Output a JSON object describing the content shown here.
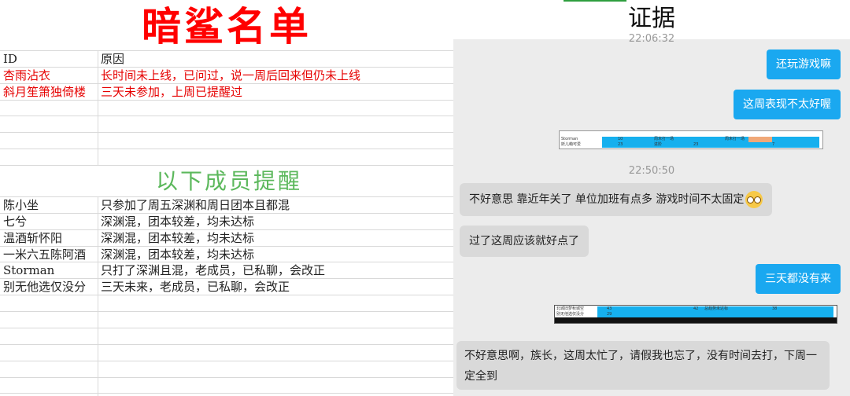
{
  "sheet": {
    "title": "暗鲨名单",
    "header": {
      "id": "ID",
      "reason": "原因"
    },
    "red_rows": [
      {
        "name": "杏雨沾衣",
        "reason": "长时间未上线，已问过，说一周后回来但仍未上线"
      },
      {
        "name": "斜月笙箫独倚楼",
        "reason": "三天未参加，上周已提醒过"
      }
    ],
    "subtitle": "以下成员提醒",
    "warn_rows": [
      {
        "name": "陈小坐",
        "reason": "只参加了周五深渊和周日团本且都混"
      },
      {
        "name": "七兮",
        "reason": "深渊混，团本较差，均未达标"
      },
      {
        "name": "温酒斩怀阳",
        "reason": "深渊混，团本较差，均未达标"
      },
      {
        "name": "一米六五陈阿酒",
        "reason": "深渊混，团本较差，均未达标"
      },
      {
        "name": "Storman",
        "reason": "只打了深渊且混，老成员，已私聊，会改正"
      },
      {
        "name": "别无他选仅没分",
        "reason": "三天未来，老成员，已私聊，会改正"
      }
    ],
    "colors": {
      "title": "#ff0000",
      "red_text": "#e60000",
      "subtitle": "#5cb85c"
    }
  },
  "chat": {
    "title": "证据",
    "timestamp_top": "22:06:32",
    "msg1": "还玩游戏嘛",
    "msg2": "这周表现不太好喔",
    "table1": {
      "rows": [
        "Storman",
        "妖儿萌可爱"
      ],
      "cells": [
        "10",
        "周末打一场",
        "周末打一场",
        "23",
        "进阶",
        "23",
        "7"
      ]
    },
    "timestamp_mid": "22:50:50",
    "reply1": "不好意思 靠近年关了 单位加班有点多  游戏时间不太固定",
    "reply2": "过了这周应该就好点了",
    "msg3": "三天都没有来",
    "table2": {
      "rows": [
        "北城旧梦秋城空",
        "别无他选仅没分"
      ],
      "cells": [
        "43",
        "42",
        "总趋势未达标",
        "38",
        "29"
      ]
    },
    "reply3": "不好意思啊，族长，这周太忙了，请假我也忘了，没有时间去打，下周一定全到",
    "colors": {
      "bubble_right": "#1aa8f0",
      "bubble_left": "#d9d9d9",
      "background": "#ececec"
    }
  }
}
